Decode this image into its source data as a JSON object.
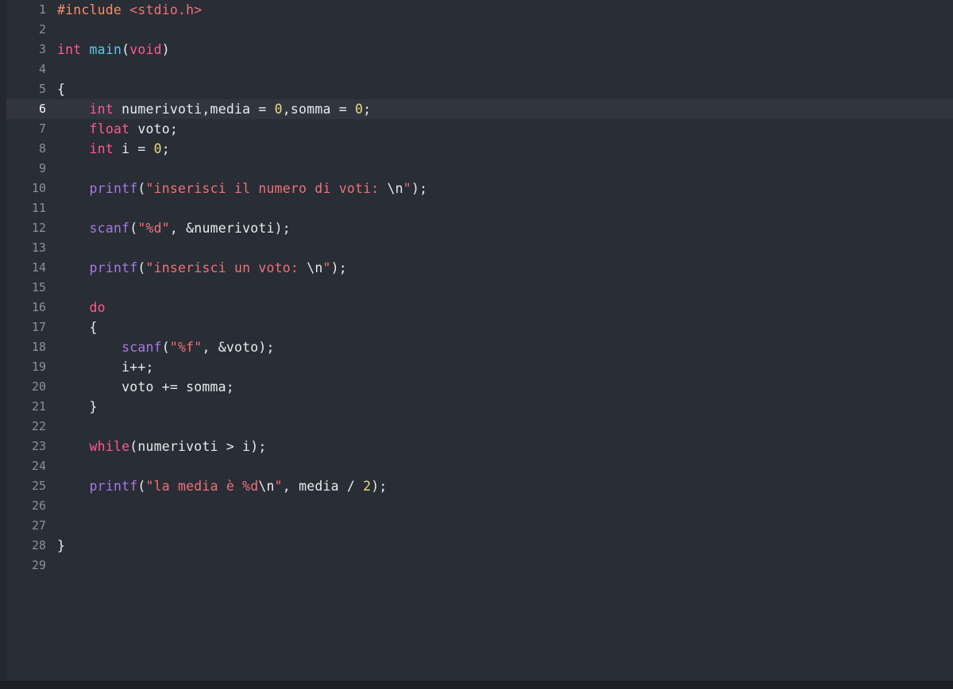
{
  "app": {
    "type": "code-editor",
    "language": "C",
    "theme": "dark",
    "colors": {
      "background": "#292d35",
      "active_line_background": "#31353f",
      "gutter_text": "#8b909a",
      "active_gutter_text": "#ffffff",
      "foreground": "#e7ecef",
      "preprocessor": "#f78c6c",
      "include_path": "#f07178",
      "keyword": "#ff5a92",
      "function_name": "#5ec8e5",
      "function_call": "#a779e3",
      "string": "#f07178",
      "escape": "#e7ecef",
      "number": "#e8dc7e",
      "status_bar": "#1c1f24"
    }
  },
  "editor": {
    "active_line": 6,
    "total_lines": 29,
    "lines": [
      {
        "n": 1,
        "tokens": [
          {
            "t": "#include",
            "c": "pre"
          },
          {
            "t": " ",
            "c": "plain"
          },
          {
            "t": "<stdio.h>",
            "c": "inc"
          }
        ]
      },
      {
        "n": 2,
        "tokens": []
      },
      {
        "n": 3,
        "tokens": [
          {
            "t": "int",
            "c": "kw"
          },
          {
            "t": " ",
            "c": "plain"
          },
          {
            "t": "main",
            "c": "fnc"
          },
          {
            "t": "(",
            "c": "plain"
          },
          {
            "t": "void",
            "c": "kw"
          },
          {
            "t": ")",
            "c": "plain"
          }
        ]
      },
      {
        "n": 4,
        "tokens": []
      },
      {
        "n": 5,
        "tokens": [
          {
            "t": "{",
            "c": "plain"
          }
        ]
      },
      {
        "n": 6,
        "tokens": [
          {
            "t": "    ",
            "c": "plain"
          },
          {
            "t": "int",
            "c": "kw"
          },
          {
            "t": " numerivoti,media = ",
            "c": "plain"
          },
          {
            "t": "0",
            "c": "num"
          },
          {
            "t": ",somma = ",
            "c": "plain"
          },
          {
            "t": "0",
            "c": "num"
          },
          {
            "t": ";",
            "c": "plain"
          }
        ]
      },
      {
        "n": 7,
        "tokens": [
          {
            "t": "    ",
            "c": "plain"
          },
          {
            "t": "float",
            "c": "kw"
          },
          {
            "t": " voto;",
            "c": "plain"
          }
        ]
      },
      {
        "n": 8,
        "tokens": [
          {
            "t": "    ",
            "c": "plain"
          },
          {
            "t": "int",
            "c": "kw"
          },
          {
            "t": " i = ",
            "c": "plain"
          },
          {
            "t": "0",
            "c": "num"
          },
          {
            "t": ";",
            "c": "plain"
          }
        ]
      },
      {
        "n": 9,
        "tokens": []
      },
      {
        "n": 10,
        "tokens": [
          {
            "t": "    ",
            "c": "plain"
          },
          {
            "t": "printf",
            "c": "call"
          },
          {
            "t": "(",
            "c": "plain"
          },
          {
            "t": "\"inserisci il numero di voti: ",
            "c": "str"
          },
          {
            "t": "\\n",
            "c": "esc"
          },
          {
            "t": "\"",
            "c": "str"
          },
          {
            "t": ");",
            "c": "plain"
          }
        ]
      },
      {
        "n": 11,
        "tokens": []
      },
      {
        "n": 12,
        "tokens": [
          {
            "t": "    ",
            "c": "plain"
          },
          {
            "t": "scanf",
            "c": "call"
          },
          {
            "t": "(",
            "c": "plain"
          },
          {
            "t": "\"%d\"",
            "c": "str"
          },
          {
            "t": ", &numerivoti);",
            "c": "plain"
          }
        ]
      },
      {
        "n": 13,
        "tokens": []
      },
      {
        "n": 14,
        "tokens": [
          {
            "t": "    ",
            "c": "plain"
          },
          {
            "t": "printf",
            "c": "call"
          },
          {
            "t": "(",
            "c": "plain"
          },
          {
            "t": "\"inserisci un voto: ",
            "c": "str"
          },
          {
            "t": "\\n",
            "c": "esc"
          },
          {
            "t": "\"",
            "c": "str"
          },
          {
            "t": ");",
            "c": "plain"
          }
        ]
      },
      {
        "n": 15,
        "tokens": []
      },
      {
        "n": 16,
        "tokens": [
          {
            "t": "    ",
            "c": "plain"
          },
          {
            "t": "do",
            "c": "kw"
          }
        ]
      },
      {
        "n": 17,
        "tokens": [
          {
            "t": "    {",
            "c": "plain"
          }
        ]
      },
      {
        "n": 18,
        "tokens": [
          {
            "t": "        ",
            "c": "plain"
          },
          {
            "t": "scanf",
            "c": "call"
          },
          {
            "t": "(",
            "c": "plain"
          },
          {
            "t": "\"%f\"",
            "c": "str"
          },
          {
            "t": ", &voto);",
            "c": "plain"
          }
        ]
      },
      {
        "n": 19,
        "tokens": [
          {
            "t": "        i++;",
            "c": "plain"
          }
        ]
      },
      {
        "n": 20,
        "tokens": [
          {
            "t": "        voto += somma;",
            "c": "plain"
          }
        ]
      },
      {
        "n": 21,
        "tokens": [
          {
            "t": "    }",
            "c": "plain"
          }
        ]
      },
      {
        "n": 22,
        "tokens": []
      },
      {
        "n": 23,
        "tokens": [
          {
            "t": "    ",
            "c": "plain"
          },
          {
            "t": "while",
            "c": "kw"
          },
          {
            "t": "(numerivoti > i);",
            "c": "plain"
          }
        ]
      },
      {
        "n": 24,
        "tokens": []
      },
      {
        "n": 25,
        "tokens": [
          {
            "t": "    ",
            "c": "plain"
          },
          {
            "t": "printf",
            "c": "call"
          },
          {
            "t": "(",
            "c": "plain"
          },
          {
            "t": "\"la media è %d",
            "c": "str"
          },
          {
            "t": "\\n",
            "c": "esc"
          },
          {
            "t": "\"",
            "c": "str"
          },
          {
            "t": ", media / ",
            "c": "plain"
          },
          {
            "t": "2",
            "c": "num"
          },
          {
            "t": ");",
            "c": "plain"
          }
        ]
      },
      {
        "n": 26,
        "tokens": []
      },
      {
        "n": 27,
        "tokens": []
      },
      {
        "n": 28,
        "tokens": [
          {
            "t": "}",
            "c": "plain"
          }
        ]
      },
      {
        "n": 29,
        "tokens": []
      }
    ],
    "source_text": "#include <stdio.h>\n\nint main(void)\n\n{\n    int numerivoti,media = 0,somma = 0;\n    float voto;\n    int i = 0;\n\n    printf(\"inserisci il numero di voti: \\n\");\n\n    scanf(\"%d\", &numerivoti);\n\n    printf(\"inserisci un voto: \\n\");\n\n    do\n    {\n        scanf(\"%f\", &voto);\n        i++;\n        voto += somma;\n    }\n\n    while(numerivoti > i);\n\n    printf(\"la media è %d\\n\", media / 2);\n\n\n}\n"
  }
}
